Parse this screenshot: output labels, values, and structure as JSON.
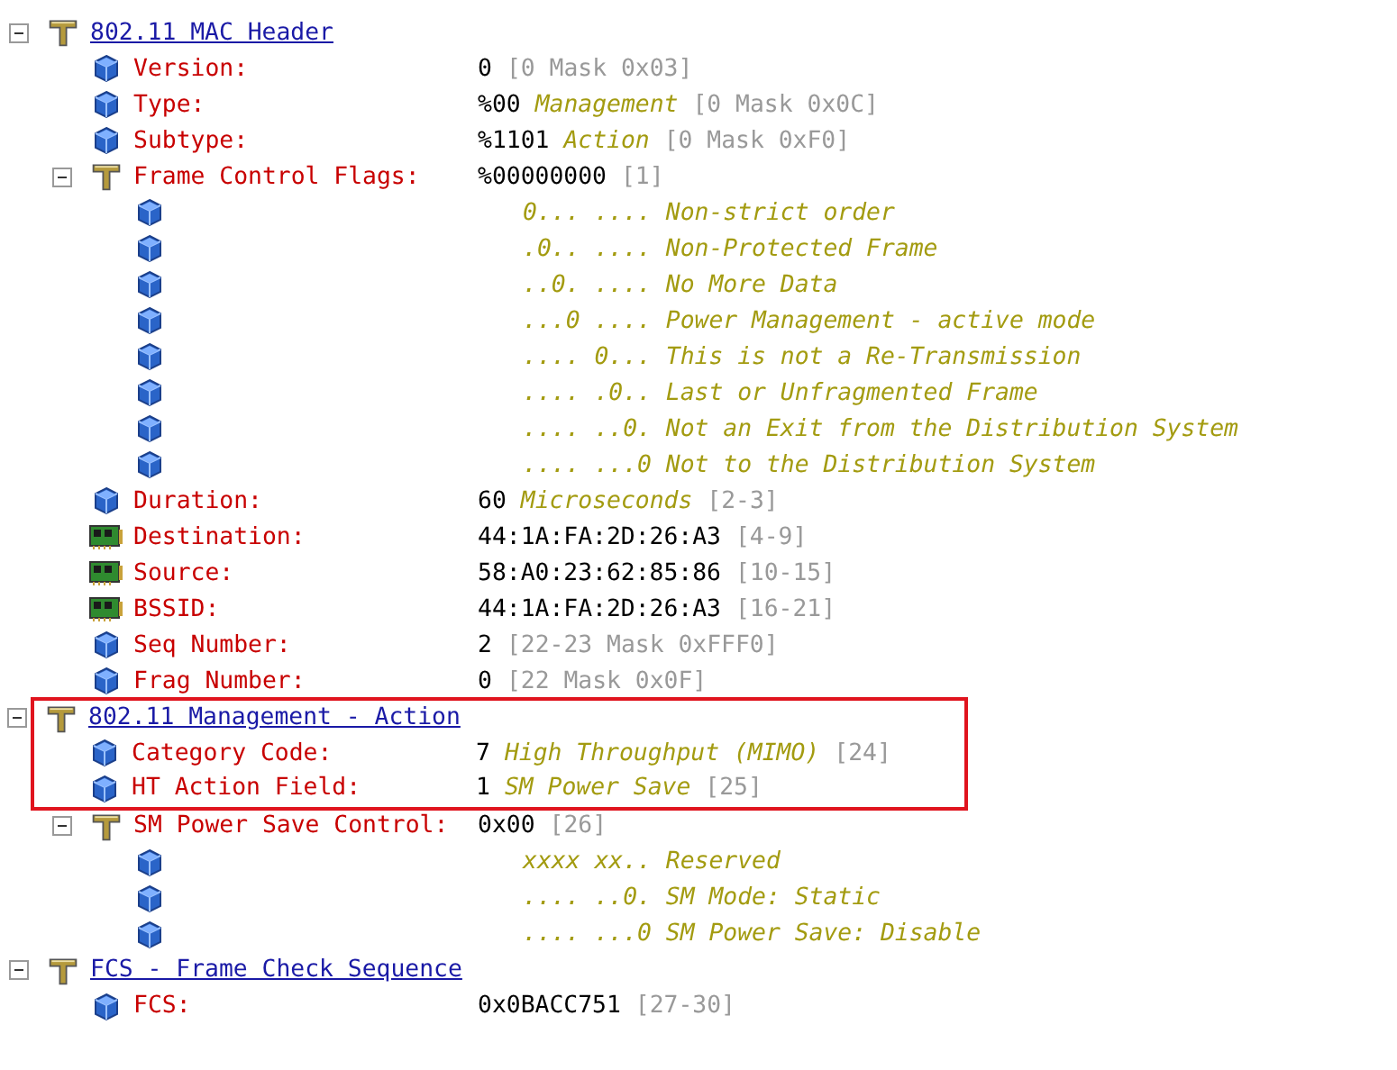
{
  "tree": [
    {
      "kind": "section",
      "label": "802.11 MAC Header",
      "expanded": true,
      "highlighted": false,
      "children": [
        {
          "kind": "field",
          "label": "Version:",
          "value": "0",
          "range": "[0 Mask 0x03]",
          "highlighted": false
        },
        {
          "kind": "field",
          "label": "Type:",
          "value": "%00",
          "description": "Management",
          "range": "[0 Mask 0x0C]",
          "highlighted": false
        },
        {
          "kind": "field",
          "label": "Subtype:",
          "value": "%1101",
          "description": "Action",
          "range": "[0 Mask 0xF0]",
          "highlighted": false
        },
        {
          "kind": "group",
          "label": "Frame Control Flags:",
          "value": "%00000000",
          "range": "[1]",
          "expanded": true,
          "highlighted": false,
          "children": [
            {
              "kind": "bit",
              "text": "0... .... Non-strict order",
              "highlighted": false
            },
            {
              "kind": "bit",
              "text": ".0.. .... Non-Protected Frame",
              "highlighted": false
            },
            {
              "kind": "bit",
              "text": "..0. .... No More Data",
              "highlighted": false
            },
            {
              "kind": "bit",
              "text": "...0 .... Power Management - active mode",
              "highlighted": false
            },
            {
              "kind": "bit",
              "text": ".... 0... This is not a Re-Transmission",
              "highlighted": false
            },
            {
              "kind": "bit",
              "text": ".... .0.. Last or Unfragmented Frame",
              "highlighted": false
            },
            {
              "kind": "bit",
              "text": ".... ..0. Not an Exit from the Distribution System",
              "highlighted": false
            },
            {
              "kind": "bit",
              "text": ".... ...0 Not to the Distribution System",
              "highlighted": false
            }
          ]
        },
        {
          "kind": "field",
          "label": "Duration:",
          "value": "60",
          "description": "Microseconds",
          "range": "[2-3]",
          "highlighted": false
        },
        {
          "kind": "address",
          "label": "Destination:",
          "value": "44:1A:FA:2D:26:A3",
          "range": "[4-9]",
          "highlighted": false
        },
        {
          "kind": "address",
          "label": "Source:",
          "value": "58:A0:23:62:85:86",
          "range": "[10-15]",
          "highlighted": false
        },
        {
          "kind": "address",
          "label": "BSSID:",
          "value": "44:1A:FA:2D:26:A3",
          "range": "[16-21]",
          "highlighted": false
        },
        {
          "kind": "field",
          "label": "Seq Number:",
          "value": "2",
          "range": "[22-23 Mask 0xFFF0]",
          "highlighted": false
        },
        {
          "kind": "field",
          "label": "Frag Number:",
          "value": "0",
          "range": "[22 Mask 0x0F]",
          "highlighted": false
        }
      ]
    },
    {
      "kind": "section",
      "label": "802.11 Management - Action",
      "expanded": true,
      "highlighted": true,
      "children": [
        {
          "kind": "field",
          "label": "Category Code:",
          "value": "7",
          "description": "High Throughput (MIMO)",
          "range": "[24]",
          "highlighted": true
        },
        {
          "kind": "field",
          "label": "HT Action Field:",
          "value": "1",
          "description": "SM Power Save",
          "range": "[25]",
          "highlighted": true
        },
        {
          "kind": "group",
          "label": "SM Power Save Control:",
          "value": "0x00",
          "range": "[26]",
          "expanded": true,
          "highlighted": false,
          "children": [
            {
              "kind": "bit",
              "text": "xxxx xx.. Reserved",
              "highlighted": false
            },
            {
              "kind": "bit",
              "text": ".... ..0. SM Mode: Static",
              "highlighted": false
            },
            {
              "kind": "bit",
              "text": ".... ...0 SM Power Save: Disable",
              "highlighted": false
            }
          ]
        }
      ]
    },
    {
      "kind": "section",
      "label": "FCS - Frame Check Sequence",
      "expanded": true,
      "highlighted": false,
      "children": [
        {
          "kind": "field",
          "label": "FCS:",
          "value": "0x0BACC751",
          "range": "[27-30]",
          "highlighted": false
        }
      ]
    }
  ]
}
